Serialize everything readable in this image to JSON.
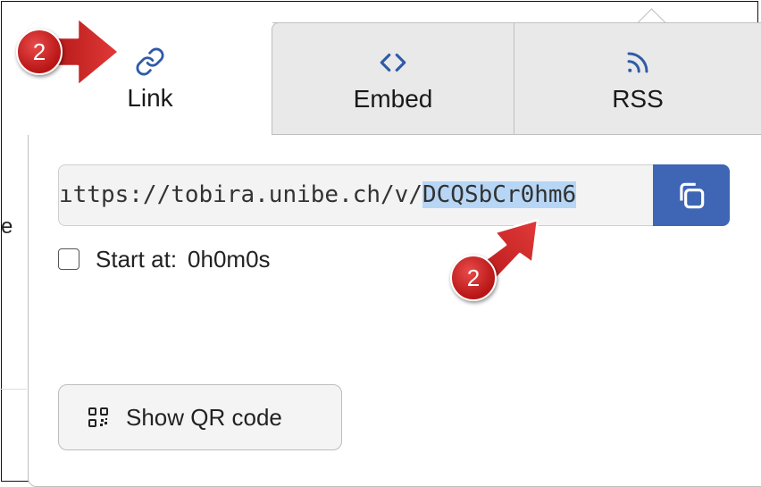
{
  "background": {
    "left_edge_text": "e"
  },
  "tabs": [
    {
      "label": "Link",
      "icon": "link-icon",
      "active": true
    },
    {
      "label": "Embed",
      "icon": "code-icon",
      "active": false
    },
    {
      "label": "RSS",
      "icon": "rss-icon",
      "active": false
    }
  ],
  "share_link": {
    "url_visible_prefix": "ıttps://tobira.unibe.ch/v/",
    "url_selected_part": "DCQSbCr0hm6",
    "copy_icon": "copy-icon"
  },
  "start_at": {
    "label": "Start at:",
    "value": "0h0m0s",
    "checked": false
  },
  "qr_button": {
    "label": "Show QR code",
    "icon": "qr-code-icon"
  },
  "annotations": [
    {
      "number": "2",
      "target": "tab-link"
    },
    {
      "number": "2",
      "target": "link-url-selection"
    }
  ],
  "colors": {
    "accent": "#3f66b5",
    "icon_blue": "#2f5aa8",
    "selection": "#b7d6f5",
    "tab_inactive": "#e9e9e9",
    "annotation_red": "#c91f1f"
  }
}
